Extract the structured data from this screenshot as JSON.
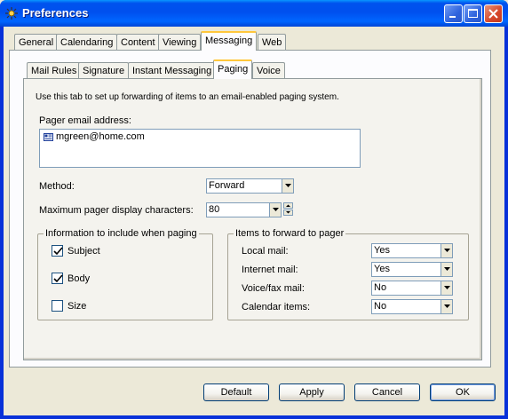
{
  "window": {
    "title": "Preferences",
    "app_icon": "preferences-icon"
  },
  "main_tabs": [
    {
      "label": "General"
    },
    {
      "label": "Calendaring"
    },
    {
      "label": "Content"
    },
    {
      "label": "Viewing"
    },
    {
      "label": "Messaging",
      "active": true
    },
    {
      "label": "Web"
    }
  ],
  "sub_tabs": [
    {
      "label": "Mail Rules"
    },
    {
      "label": "Signature"
    },
    {
      "label": "Instant Messaging"
    },
    {
      "label": "Paging",
      "active": true
    },
    {
      "label": "Voice"
    }
  ],
  "paging": {
    "description": "Use this tab to set up forwarding of items to an email-enabled paging system.",
    "pager_email_label": "Pager email address:",
    "pager_email_entries": [
      {
        "text": "mgreen@home.com",
        "icon": "contact-card-icon"
      }
    ],
    "method_label": "Method:",
    "method_value": "Forward",
    "max_chars_label": "Maximum pager display characters:",
    "max_chars_value": "80",
    "include_group_title": "Information to include when paging",
    "include_options": [
      {
        "label": "Subject",
        "checked": true
      },
      {
        "label": "Body",
        "checked": true
      },
      {
        "label": "Size",
        "checked": false
      }
    ],
    "forward_group_title": "Items to forward to pager",
    "forward_items": [
      {
        "label": "Local mail:",
        "value": "Yes"
      },
      {
        "label": "Internet mail:",
        "value": "Yes"
      },
      {
        "label": "Voice/fax mail:",
        "value": "No"
      },
      {
        "label": "Calendar items:",
        "value": "No"
      }
    ]
  },
  "buttons": {
    "default": "Default",
    "apply": "Apply",
    "cancel": "Cancel",
    "ok": "OK"
  }
}
